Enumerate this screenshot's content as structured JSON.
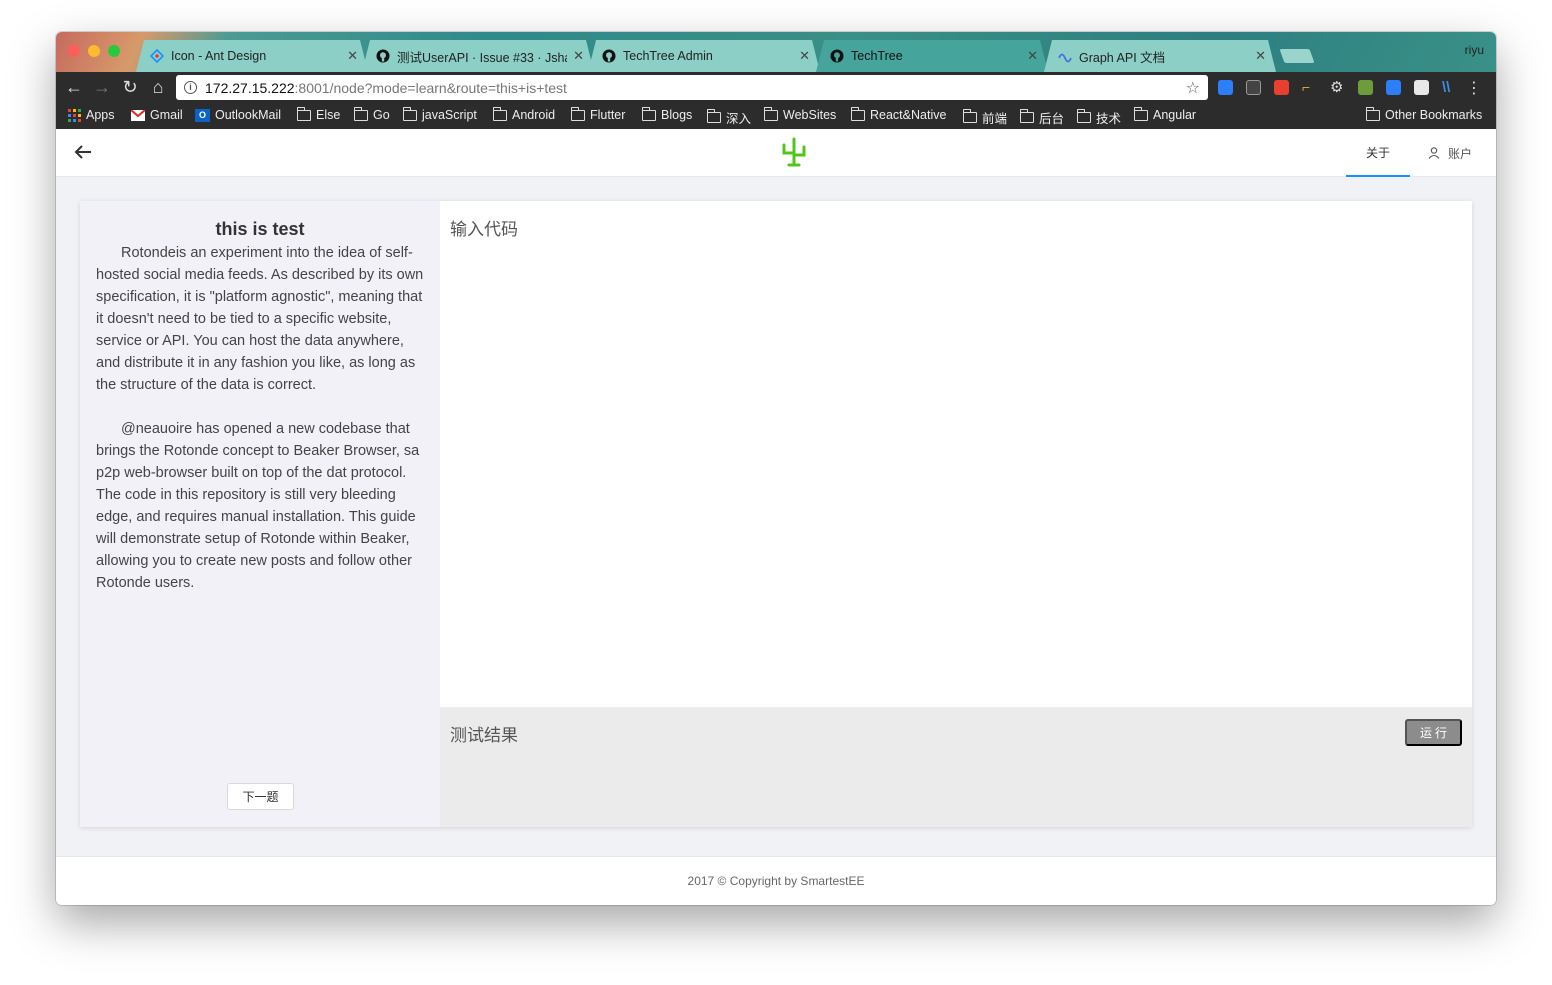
{
  "browser": {
    "profile": "riyu",
    "tabs": [
      {
        "title": "Icon - Ant Design",
        "icon": "ant-design-icon"
      },
      {
        "title": "测试UserAPI · Issue #33 · Jsha",
        "icon": "github-icon"
      },
      {
        "title": "TechTree Admin",
        "icon": "github-icon"
      },
      {
        "title": "TechTree",
        "icon": "github-icon",
        "active": true
      },
      {
        "title": "Graph API 文档",
        "icon": "graph-api-icon"
      }
    ],
    "url_host": "172.27.15.222",
    "url_rest": ":8001/node?mode=learn&route=this+is+test",
    "bookmarks": [
      "Apps",
      "Gmail",
      "OutlookMail",
      "Else",
      "Go",
      "javaScript",
      "Android",
      "Flutter",
      "Blogs",
      "深入",
      "WebSites",
      "React&Native",
      "前端",
      "后台",
      "技术",
      "Angular"
    ],
    "other_bookmarks": "Other Bookmarks"
  },
  "header": {
    "about": "关于",
    "account": "账户",
    "accent_color": "#1890ff",
    "logo_color": "#52c41a"
  },
  "lesson": {
    "title": "this is test",
    "paragraphs": [
      "Rotondeis an experiment into the idea of self-hosted social media feeds. As described by its own specification, it is \"platform agnostic\", meaning that it doesn't need to be tied to a specific website, service or API. You can host the data anywhere, and distribute it in any fashion you like, as long as the structure of the data is correct.",
      "@neauoire has opened a new codebase that brings the Rotonde concept to Beaker Browser, sa p2p web-browser built on top of the dat protocol. The code in this repository is still very bleeding edge, and requires manual installation. This guide will demonstrate setup of Rotonde within Beaker, allowing you to create new posts and follow other Rotonde users."
    ],
    "next_button": "下一题"
  },
  "editor": {
    "label": "输入代码"
  },
  "results": {
    "label": "测试结果",
    "run_button": "运行"
  },
  "footer": {
    "copyright": "2017 © Copyright by SmartestEE"
  }
}
